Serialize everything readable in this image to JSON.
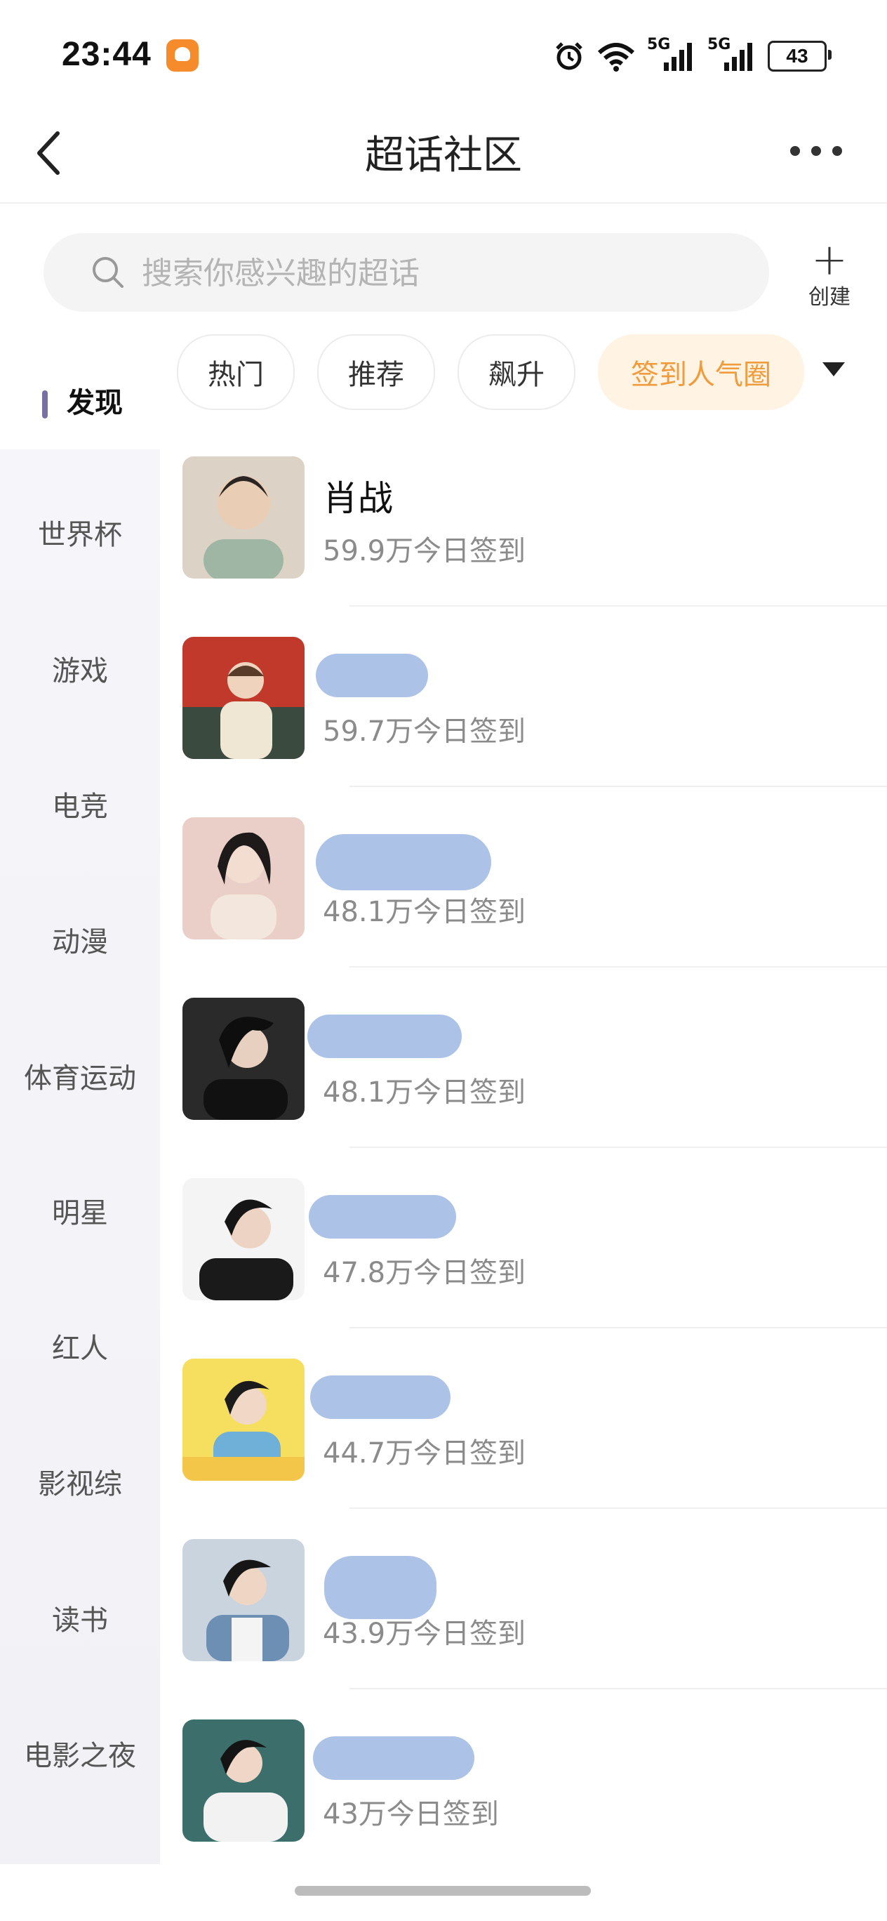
{
  "status": {
    "time": "23:44",
    "battery": "43",
    "signal1": "5G",
    "signal2": "5G"
  },
  "nav": {
    "title": "超话社区"
  },
  "search": {
    "placeholder": "搜索你感兴趣的超话",
    "create_label": "创建"
  },
  "sidebar": {
    "items": [
      {
        "label": "发现",
        "active": true
      },
      {
        "label": "世界杯"
      },
      {
        "label": "游戏"
      },
      {
        "label": "电竞"
      },
      {
        "label": "动漫"
      },
      {
        "label": "体育运动"
      },
      {
        "label": "明星"
      },
      {
        "label": "红人"
      },
      {
        "label": "影视综"
      },
      {
        "label": "读书"
      },
      {
        "label": "电影之夜"
      }
    ]
  },
  "chips": [
    {
      "label": "热门"
    },
    {
      "label": "推荐"
    },
    {
      "label": "飙升"
    },
    {
      "label": "签到人气圈",
      "active": true
    }
  ],
  "list": [
    {
      "name": "肖战",
      "checkin": "59.9万今日签到",
      "masked": false,
      "avatar_color": "#d8c9b8"
    },
    {
      "name": "",
      "checkin": "59.7万今日签到",
      "masked": true,
      "avatar_color": "#c0392b"
    },
    {
      "name": "",
      "checkin": "48.1万今日签到",
      "masked": true,
      "avatar_color": "#e7c9c4"
    },
    {
      "name": "",
      "checkin": "48.1万今日签到",
      "masked": true,
      "avatar_color": "#2b2b2b"
    },
    {
      "name": "",
      "checkin": "47.8万今日签到",
      "masked": true,
      "avatar_color": "#f2f2f2"
    },
    {
      "name": "",
      "checkin": "44.7万今日签到",
      "masked": true,
      "avatar_color": "#f6df5e"
    },
    {
      "name": "",
      "checkin": "43.9万今日签到",
      "masked": true,
      "avatar_color": "#a9bcd0"
    },
    {
      "name": "",
      "checkin": "43万今日签到",
      "masked": true,
      "avatar_color": "#3c6f6b"
    }
  ],
  "colors": {
    "accent": "#f09b3c",
    "accent_bg": "#fff3e3",
    "sidebar_indicator": "#7a6fa2",
    "mask": "#a8c0e6"
  }
}
